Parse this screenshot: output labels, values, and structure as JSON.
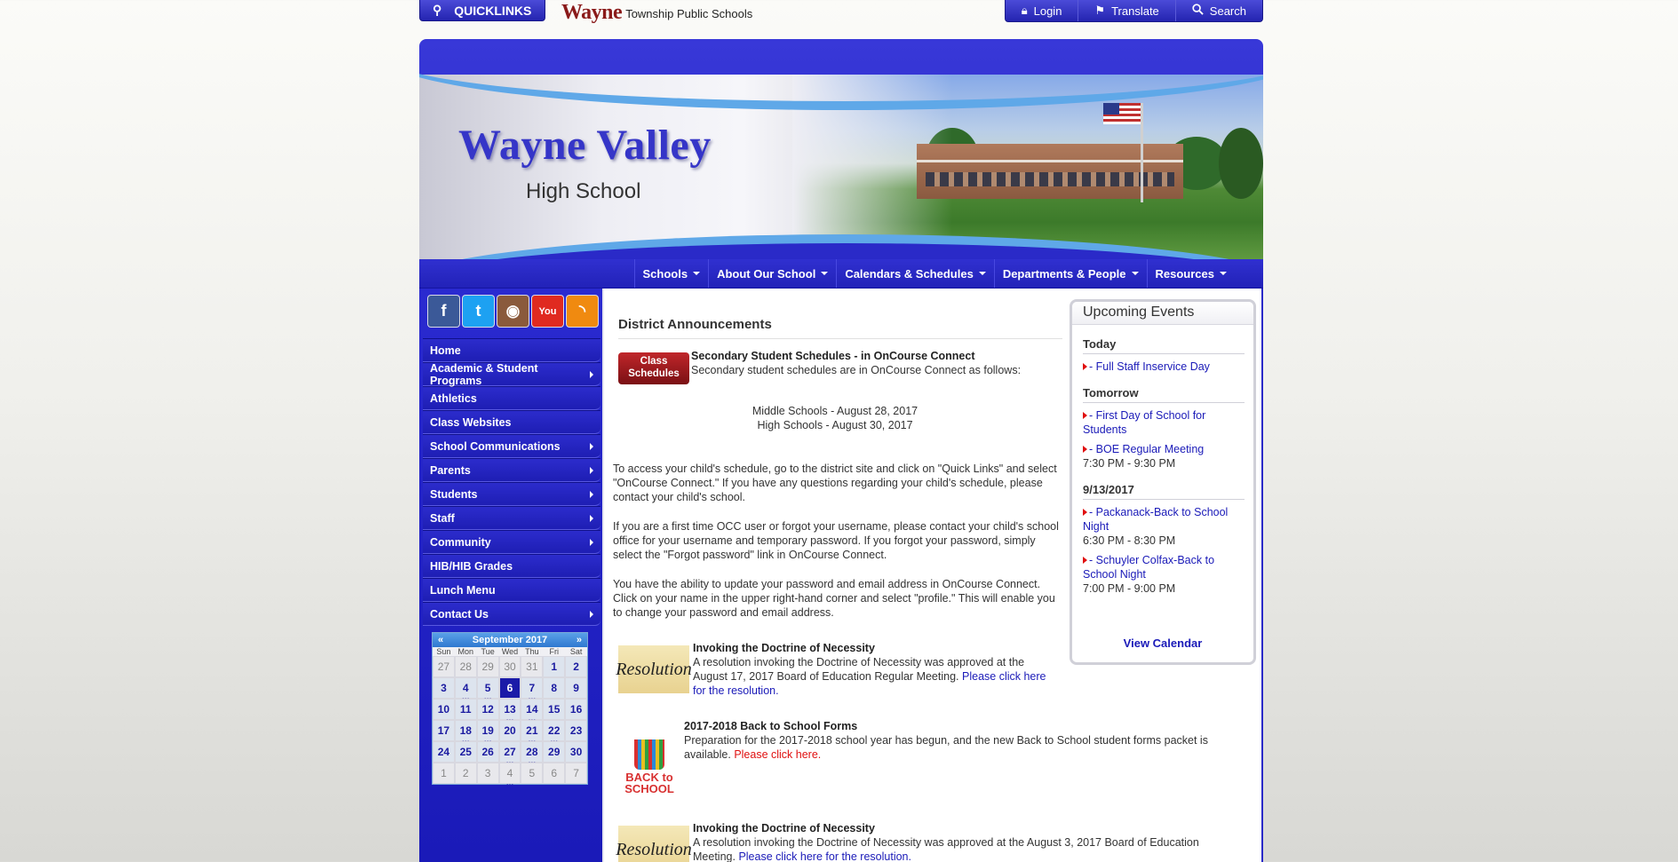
{
  "topbar": {
    "quicklinks": "QUICKLINKS",
    "brand_name": "Wayne",
    "brand_rest": "Township Public Schools",
    "tools": [
      {
        "label": "Login",
        "icon": "lock-icon"
      },
      {
        "label": "Translate",
        "icon": "flag-icon"
      },
      {
        "label": "Search",
        "icon": "search-icon"
      }
    ]
  },
  "banner": {
    "title": "Wayne Valley",
    "subtitle": "High School"
  },
  "mainnav": [
    "Schools",
    "About Our School",
    "Calendars & Schedules",
    "Departments & People",
    "Resources"
  ],
  "social": [
    {
      "label": "f",
      "color": "#3b5998",
      "name": "facebook-icon"
    },
    {
      "label": "t",
      "color": "#1da1f2",
      "name": "twitter-icon"
    },
    {
      "label": "◉",
      "color": "#8a5a3c",
      "name": "instagram-icon"
    },
    {
      "label": "You",
      "color": "#e02a20",
      "name": "youtube-icon"
    },
    {
      "label": "◝",
      "color": "#f08a10",
      "name": "rss-icon"
    }
  ],
  "leftmenu": [
    {
      "label": "Home",
      "sub": false
    },
    {
      "label": "Academic & Student Programs",
      "sub": true
    },
    {
      "label": "Athletics",
      "sub": false
    },
    {
      "label": "Class Websites",
      "sub": false
    },
    {
      "label": "School Communications",
      "sub": true
    },
    {
      "label": "Parents",
      "sub": true
    },
    {
      "label": "Students",
      "sub": true
    },
    {
      "label": "Staff",
      "sub": true
    },
    {
      "label": "Community",
      "sub": true
    },
    {
      "label": "HIB/HIB Grades",
      "sub": false
    },
    {
      "label": "Lunch Menu",
      "sub": false
    },
    {
      "label": "Contact Us",
      "sub": true
    }
  ],
  "calendar": {
    "prev": "«",
    "next": "»",
    "month": "September 2017",
    "dow": [
      "Sun",
      "Mon",
      "Tue",
      "Wed",
      "Thu",
      "Fri",
      "Sat"
    ],
    "days": [
      {
        "d": "27",
        "o": true
      },
      {
        "d": "28",
        "o": true
      },
      {
        "d": "29",
        "o": true
      },
      {
        "d": "30",
        "o": true
      },
      {
        "d": "31",
        "o": true
      },
      {
        "d": "1"
      },
      {
        "d": "2"
      },
      {
        "d": "3"
      },
      {
        "d": "4",
        "e": true
      },
      {
        "d": "5",
        "e": true
      },
      {
        "d": "6",
        "t": true
      },
      {
        "d": "7",
        "e": true
      },
      {
        "d": "8"
      },
      {
        "d": "9"
      },
      {
        "d": "10"
      },
      {
        "d": "11"
      },
      {
        "d": "12"
      },
      {
        "d": "13",
        "e": true
      },
      {
        "d": "14",
        "e": true
      },
      {
        "d": "15"
      },
      {
        "d": "16"
      },
      {
        "d": "17"
      },
      {
        "d": "18",
        "e": true
      },
      {
        "d": "19",
        "e": true
      },
      {
        "d": "20"
      },
      {
        "d": "21",
        "e": true
      },
      {
        "d": "22",
        "e": true
      },
      {
        "d": "23"
      },
      {
        "d": "24"
      },
      {
        "d": "25"
      },
      {
        "d": "26"
      },
      {
        "d": "27",
        "e": true
      },
      {
        "d": "28",
        "e": true
      },
      {
        "d": "29"
      },
      {
        "d": "30"
      },
      {
        "d": "1",
        "o": true
      },
      {
        "d": "2",
        "o": true
      },
      {
        "d": "3",
        "o": true
      },
      {
        "d": "4",
        "o": true,
        "e": true
      },
      {
        "d": "5",
        "o": true
      },
      {
        "d": "6",
        "o": true
      },
      {
        "d": "7",
        "o": true
      }
    ]
  },
  "content": {
    "heading": "District Announcements",
    "ann1": {
      "thumb": "Class Schedules",
      "title": "Secondary Student Schedules - in OnCourse Connect",
      "intro": "Secondary student schedules are in OnCourse Connect as follows:",
      "ms": "Middle Schools - August 28, 2017",
      "hs": "High Schools - August 30, 2017",
      "p1": "To access your child's schedule, go to the district site and click on \"Quick Links\" and select \"OnCourse Connect.\"  If you have any questions regarding your child's schedule, please contact your child's school.",
      "p2": "If you are a first time OCC user or forgot your username, please contact your child's school office for your username and temporary password.  If you forgot your password, simply select the \"Forgot password\" link in OnCourse Connect.",
      "p3": "You have the ability to update your password and email address in OnCourse Connect.  Click on your name in the upper right-hand corner and select \"profile.\"  This will enable you to change your password and email address."
    },
    "ann2": {
      "thumb": "Resolution",
      "title": "Invoking the Doctrine of Necessity",
      "text": "A resolution invoking the Doctrine of Necessity was approved at the August 17, 2017 Board of Education Regular Meeting.",
      "link": "Please click here for the resolution."
    },
    "ann3": {
      "thumb_word": "BACK to SCHOOL",
      "title": "2017-2018 Back to School Forms",
      "text": "Preparation for the 2017-2018 school year has begun, and the new Back to School student forms packet is available.",
      "link": "Please click here."
    },
    "ann4": {
      "thumb": "Resolution",
      "title": "Invoking the Doctrine of Necessity",
      "text": "A resolution invoking the Doctrine of Necessity was approved at the August 3, 2017 Board of Education Meeting.",
      "link": "Please click here for the resolution."
    }
  },
  "events": {
    "heading": "Upcoming Events",
    "groups": [
      {
        "date": "Today",
        "items": [
          {
            "title": "- Full Staff Inservice Day",
            "time": ""
          }
        ]
      },
      {
        "date": "Tomorrow",
        "items": [
          {
            "title": "- First Day of School for Students",
            "time": ""
          },
          {
            "title": "- BOE Regular Meeting",
            "time": "7:30 PM - 9:30 PM"
          }
        ]
      },
      {
        "date": "9/13/2017",
        "items": [
          {
            "title": "- Packanack-Back to School Night",
            "time": "6:30 PM - 8:30 PM"
          },
          {
            "title": "- Schuyler Colfax-Back to School Night",
            "time": "7:00 PM - 9:00 PM"
          }
        ]
      }
    ],
    "view_calendar": "View Calendar"
  },
  "colors": {
    "brand_blue": "#2a2ac8",
    "link_blue": "#1a1ab8",
    "alert_red": "#e01010",
    "brand_red": "#8a1a1a"
  }
}
